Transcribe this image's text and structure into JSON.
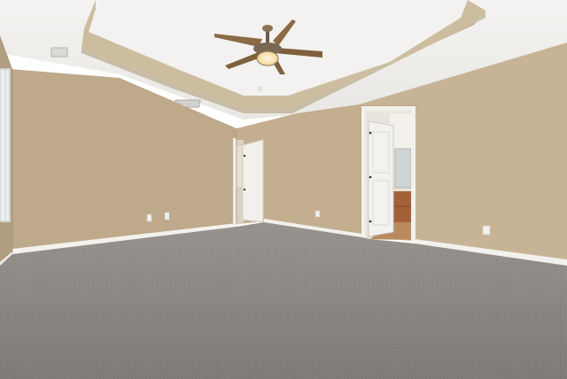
{
  "scene": {
    "description_visible_text": "",
    "colors": {
      "ceiling": "#f1f0ee",
      "tray_band": "#c8b89b",
      "wall_left": "#bda98a",
      "wall_back": "#c2ae8f",
      "wall_right": "#c6b394",
      "carpet": "#8a8783",
      "baseboard": "#f4f2ee",
      "door": "#f2f1ee",
      "trim": "#eeece7",
      "bath_cabinet": "#a3613a",
      "bath_floor": "#b98a5e",
      "window": "#e9eef2",
      "fan_blade": "#8e6d48",
      "fan_light": "#fbf3d8"
    }
  }
}
